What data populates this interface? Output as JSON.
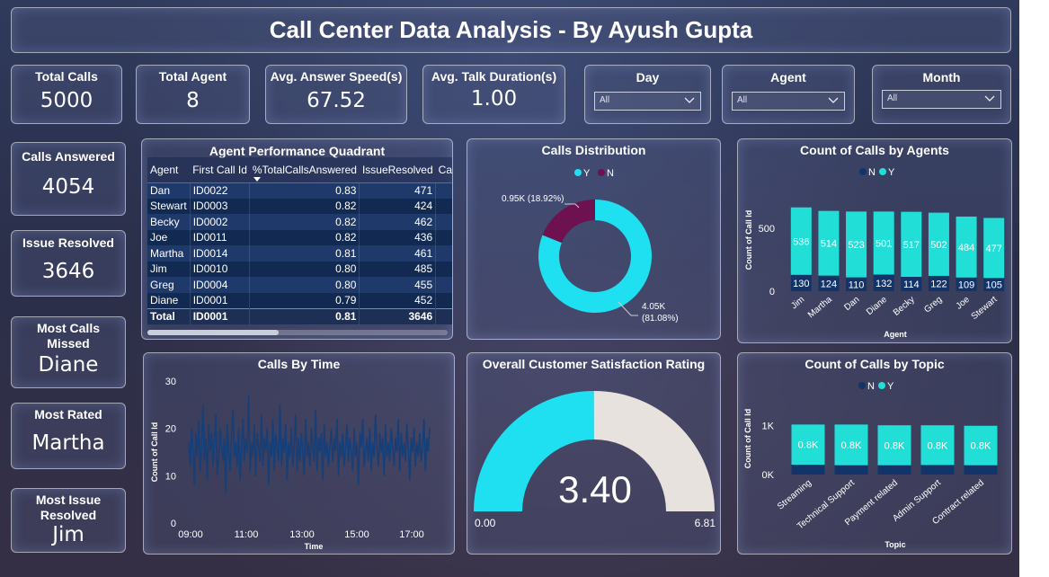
{
  "title": "Call Center Data Analysis - By Ayush Gupta",
  "kpis": {
    "total_calls": {
      "label": "Total Calls",
      "value": "5000"
    },
    "total_agent": {
      "label": "Total Agent",
      "value": "8"
    },
    "avg_speed": {
      "label": "Avg. Answer Speed(s)",
      "value": "67.52"
    },
    "avg_talk": {
      "label": "Avg. Talk Duration(s)",
      "value": "1.00"
    },
    "calls_answered": {
      "label": "Calls Answered",
      "value": "4054"
    },
    "issue_resolved": {
      "label": "Issue Resolved",
      "value": "3646"
    },
    "most_missed": {
      "label1": "Most Calls",
      "label2": "Missed",
      "value": "Diane"
    },
    "most_rated": {
      "label": "Most Rated",
      "value": "Martha"
    },
    "most_resolved": {
      "label1": "Most Issue",
      "label2": "Resolved",
      "value": "Jim"
    }
  },
  "slicers": {
    "day": {
      "label": "Day",
      "value": "All"
    },
    "agent": {
      "label": "Agent",
      "value": "All"
    },
    "month": {
      "label": "Month",
      "value": "All"
    }
  },
  "colors": {
    "cyan": "#1fe0f0",
    "teal": "#21dfd7",
    "maroon": "#6d1150",
    "navy": "#123469",
    "gauge_rest": "#e8e2df",
    "line": "#163f78"
  },
  "chart_data": [
    {
      "type": "table",
      "title": "Agent Performance Quadrant",
      "columns": [
        "Agent",
        "First Call Id",
        "%TotalCallsAnswered",
        "IssueResolved",
        "Ca"
      ],
      "rows": [
        [
          "Dan",
          "ID0022",
          "0.83",
          "471"
        ],
        [
          "Stewart",
          "ID0003",
          "0.82",
          "424"
        ],
        [
          "Becky",
          "ID0002",
          "0.82",
          "462"
        ],
        [
          "Joe",
          "ID0011",
          "0.82",
          "436"
        ],
        [
          "Martha",
          "ID0014",
          "0.81",
          "461"
        ],
        [
          "Jim",
          "ID0010",
          "0.80",
          "485"
        ],
        [
          "Greg",
          "ID0004",
          "0.80",
          "455"
        ],
        [
          "Diane",
          "ID0001",
          "0.79",
          "452"
        ]
      ],
      "total": [
        "Total",
        "ID0001",
        "0.81",
        "3646"
      ]
    },
    {
      "type": "pie",
      "title": "Calls Distribution",
      "legend": [
        "Y",
        "N"
      ],
      "slices": [
        {
          "name": "Y",
          "value": 4054,
          "label1": "4.05K",
          "label2": "(81.08%)"
        },
        {
          "name": "N",
          "value": 946,
          "label1": "0.95K (18.92%)"
        }
      ]
    },
    {
      "type": "bar",
      "title": "Count of Calls by Agents",
      "legend": [
        "N",
        "Y"
      ],
      "categories": [
        "Jim",
        "Martha",
        "Dan",
        "Diane",
        "Becky",
        "Greg",
        "Joe",
        "Stewart"
      ],
      "series": [
        {
          "name": "N",
          "values": [
            130,
            124,
            110,
            132,
            114,
            122,
            109,
            105
          ]
        },
        {
          "name": "Y",
          "values": [
            536,
            514,
            523,
            501,
            517,
            502,
            484,
            477
          ]
        }
      ],
      "ylabel": "Count of Call Id",
      "xlabel": "Agent",
      "yticks": [
        "0",
        "500"
      ],
      "ylim": [
        0,
        750
      ]
    },
    {
      "type": "line",
      "title": "Calls By Time",
      "ylabel": "Count of Call Id",
      "xlabel": "Time",
      "xticks": [
        "09:00",
        "11:00",
        "13:00",
        "15:00",
        "17:00"
      ],
      "yticks": [
        "0",
        "10",
        "20",
        "30"
      ],
      "ylim": [
        0,
        30
      ],
      "values": [
        17,
        12,
        20,
        15,
        8,
        19,
        14,
        22,
        11,
        16,
        25,
        13,
        18,
        9,
        21,
        15,
        19,
        12,
        17,
        23,
        10,
        14,
        20,
        16,
        13,
        18,
        6,
        21,
        15,
        11,
        19,
        24,
        14,
        17,
        12,
        20,
        9,
        16,
        22,
        13,
        18,
        15,
        27,
        11,
        17,
        14,
        21,
        10,
        19,
        16,
        13,
        23,
        12,
        18,
        15,
        20,
        8,
        17,
        14,
        22,
        11,
        19,
        16,
        13,
        25,
        12,
        18,
        15,
        21,
        9,
        17,
        14,
        20,
        12,
        16,
        23,
        11,
        18,
        13,
        19,
        15,
        10,
        22,
        14,
        17,
        12,
        20,
        16,
        13,
        24,
        11,
        18,
        15,
        19,
        9,
        21,
        14,
        17,
        12,
        16,
        20,
        13,
        18,
        15,
        22,
        10,
        17,
        14,
        19,
        12,
        16,
        21,
        13,
        18,
        15,
        11,
        20,
        14,
        17,
        8,
        19,
        16,
        22,
        12,
        15,
        18,
        13,
        20,
        11,
        17,
        14,
        23,
        16,
        12,
        19,
        15,
        18,
        10,
        21,
        14,
        17,
        13,
        20,
        16,
        12,
        18,
        15,
        22,
        11,
        19,
        14,
        17,
        13,
        21,
        16,
        9,
        18,
        15,
        20,
        12,
        17,
        14,
        19,
        13,
        16,
        22,
        11,
        18,
        15,
        20
      ]
    },
    {
      "type": "gauge",
      "title": "Overall Customer Satisfaction Rating",
      "value": "3.40",
      "min": "0.00",
      "max": "6.81"
    },
    {
      "type": "bar",
      "title": "Count of Calls by Topic",
      "legend": [
        "N",
        "Y"
      ],
      "categories": [
        "Streaming",
        "Technical Support",
        "Payment related",
        "Admin Support",
        "Contract related"
      ],
      "series": [
        {
          "name": "N",
          "values": [
            200,
            190,
            190,
            195,
            190
          ]
        },
        {
          "name": "Y",
          "values": [
            820,
            830,
            815,
            810,
            805
          ],
          "labels": [
            "0.8K",
            "0.8K",
            "0.8K",
            "0.8K",
            "0.8K"
          ]
        }
      ],
      "ylabel": "Count of Call Id",
      "xlabel": "Topic",
      "yticks": [
        "0K",
        "1K"
      ],
      "ylim": [
        0,
        1100
      ]
    }
  ]
}
